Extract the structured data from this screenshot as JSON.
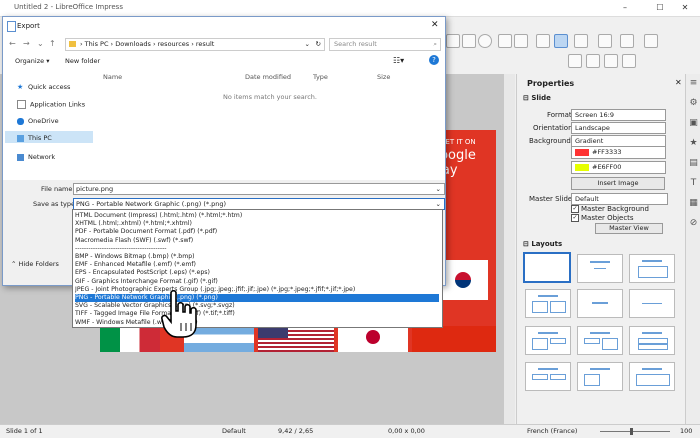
{
  "window": {
    "title": "Untitled 2 - LibreOffice Impress"
  },
  "slide_texts": {
    "google_play": "Google play",
    "get_it_on": "GET IT ON"
  },
  "sidebar": {
    "title": "Properties",
    "slide_section": "Slide",
    "format_label": "Format:",
    "format_value": "Screen 16:9",
    "orientation_label": "Orientation:",
    "orientation_value": "Landscape",
    "background_label": "Background:",
    "background_value": "Gradient",
    "color1": "#FF3333",
    "color2": "#E6FF00",
    "insert_image": "Insert Image",
    "master_slide_label": "Master Slide:",
    "master_slide_value": "Default",
    "master_background": "Master Background",
    "master_objects": "Master Objects",
    "master_view": "Master View",
    "layouts_section": "Layouts"
  },
  "statusbar": {
    "slide": "Slide 1 of 1",
    "layout": "Default",
    "position": "9,42 / 2,65",
    "size": "0,00 x 0,00",
    "language": "French (France)",
    "zoom": "100"
  },
  "dialog": {
    "title": "Export",
    "path": [
      "This PC",
      "Downloads",
      "resources",
      "result"
    ],
    "search_placeholder": "Search result",
    "organize": "Organize",
    "new_folder": "New folder",
    "nav_items": [
      "Quick access",
      "Application Links",
      "OneDrive",
      "This PC",
      "Network"
    ],
    "columns": [
      "Name",
      "Date modified",
      "Type",
      "Size"
    ],
    "empty_text": "No items match your search.",
    "file_name_label": "File name:",
    "file_name_value": "picture.png",
    "save_as_type_label": "Save as type:",
    "save_as_type_value": "PNG - Portable Network Graphic (.png) (*.png)",
    "hide_folders": "Hide Folders",
    "type_options": [
      "HTML Document (Impress) (.html;.htm) (*.html;*.htm)",
      "XHTML (.html;.xhtml) (*.html;*.xhtml)",
      "PDF - Portable Document Format (.pdf) (*.pdf)",
      "Macromedia Flash (SWF) (.swf) (*.swf)",
      "-----------------------------------------",
      "BMP - Windows Bitmap (.bmp) (*.bmp)",
      "EMF - Enhanced Metafile (.emf) (*.emf)",
      "EPS - Encapsulated PostScript (.eps) (*.eps)",
      "GIF - Graphics Interchange Format (.gif) (*.gif)",
      "JPEG - Joint Photographic Experts Group (.jpg;.jpeg;.jfif;.jif;.jpe) (*.jpg;*.jpeg;*.jfif;*.jif;*.jpe)",
      "PNG - Portable Network Graphic (.png) (*.png)",
      "SVG - Scalable Vector Graphics (.svg) (*.svg;*.svgz)",
      "TIFF - Tagged Image File Format (.tif;.tiff) (*.tif;*.tiff)",
      "WMF - Windows Metafile (.wmf) (*.wmf)"
    ],
    "selected_option_index": 10
  },
  "colors": {
    "accent": "#1E78D6",
    "slide_bg": "#E03524"
  }
}
